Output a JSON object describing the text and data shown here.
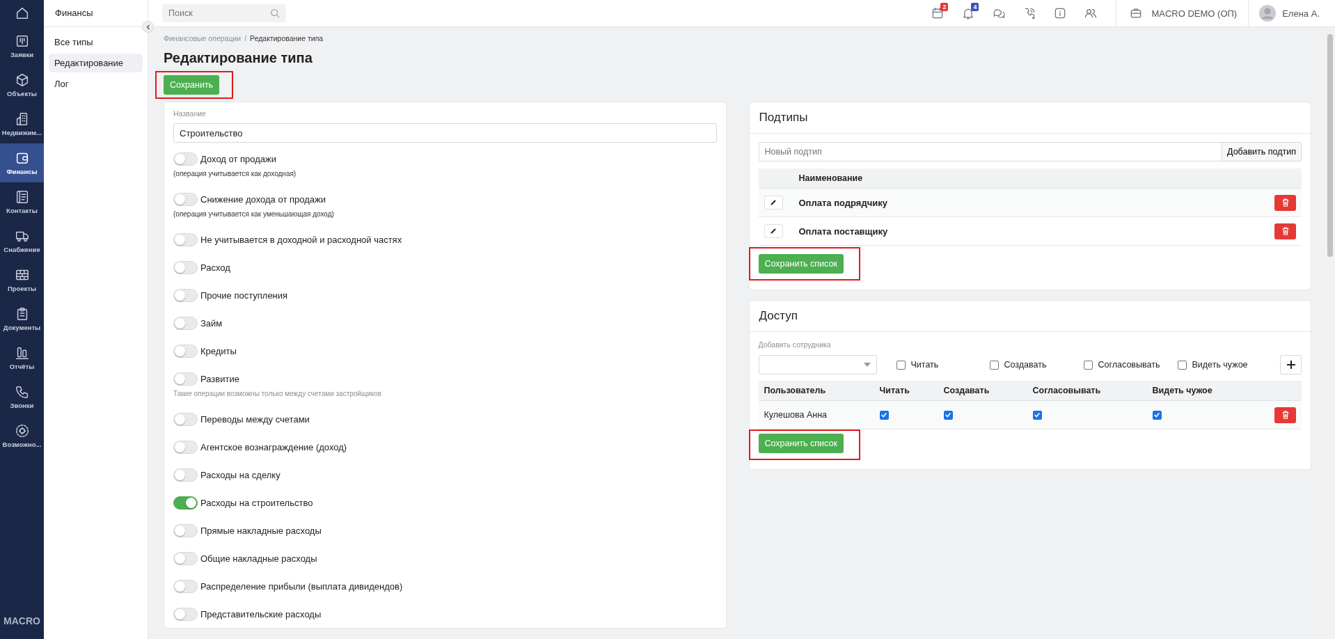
{
  "rail": {
    "items": [
      {
        "kind": "home",
        "selected": false
      },
      {
        "kind": "board",
        "label": "Заявки",
        "selected": false
      },
      {
        "kind": "cube",
        "label": "Объекты",
        "selected": false
      },
      {
        "kind": "building",
        "label": "Недвижим...",
        "selected": false
      },
      {
        "kind": "wallet",
        "label": "Финансы",
        "selected": true
      },
      {
        "kind": "contacts",
        "label": "Контакты",
        "selected": false
      },
      {
        "kind": "truck",
        "label": "Снабжение",
        "selected": false
      },
      {
        "kind": "bricks",
        "label": "Проекты",
        "selected": false
      },
      {
        "kind": "clipboard",
        "label": "Документы",
        "selected": false
      },
      {
        "kind": "reports",
        "label": "Отчёты",
        "selected": false
      },
      {
        "kind": "phone",
        "label": "Звонки",
        "selected": false
      },
      {
        "kind": "gear",
        "label": "Возможно...",
        "selected": false
      }
    ],
    "logo": "MACRO"
  },
  "sidebar": {
    "title": "Финансы",
    "items": [
      {
        "label": "Все типы",
        "selected": false
      },
      {
        "label": "Редактирование",
        "selected": true
      },
      {
        "label": "Лог",
        "selected": false
      }
    ]
  },
  "topbar": {
    "search": {
      "placeholder": "Поиск"
    },
    "icons": [
      {
        "kind": "calendar",
        "badge": "2",
        "color": "#e53935"
      },
      {
        "kind": "bell",
        "badge": "4",
        "color": "#3f51b5"
      },
      {
        "kind": "chats"
      },
      {
        "kind": "phone"
      },
      {
        "kind": "info"
      },
      {
        "kind": "users"
      }
    ],
    "company": "MACRO DEMO (ОП)",
    "user": "Елена А."
  },
  "breadcrumb_separator": "/",
  "breadcrumb": [
    {
      "label": "Финансовые операции"
    },
    {
      "label": "Редактирование типа"
    }
  ],
  "title": "Редактирование типа",
  "save_button": {
    "label": "Сохранить",
    "highlighted": true
  },
  "form": {
    "name_label": "Название",
    "name_value": "Строительство",
    "toggles": [
      {
        "label": "Доход от продажи",
        "on": false,
        "hint": "(операция учитывается как доходная)",
        "hint_muted": false
      },
      {
        "label": "Снижение дохода от продажи",
        "on": false,
        "hint": "(операция учитывается как уменьшающая доход)",
        "hint_muted": false
      },
      {
        "label": "Не учитывается в доходной и расходной частях",
        "on": false
      },
      {
        "label": "Расход",
        "on": false
      },
      {
        "label": "Прочие поступления",
        "on": false
      },
      {
        "label": "Займ",
        "on": false
      },
      {
        "label": "Кредиты",
        "on": false
      },
      {
        "label": "Развитие",
        "on": false,
        "hint": "Такие операции возможны только между счетами застройщиков",
        "hint_muted": true
      },
      {
        "label": "Переводы между счетами",
        "on": false
      },
      {
        "label": "Агентское вознаграждение (доход)",
        "on": false
      },
      {
        "label": "Расходы на сделку",
        "on": false
      },
      {
        "label": "Расходы на строительство",
        "on": true
      },
      {
        "label": "Прямые накладные расходы",
        "on": false
      },
      {
        "label": "Общие накладные расходы",
        "on": false
      },
      {
        "label": "Распределение прибыли (выплата дивидендов)",
        "on": false
      },
      {
        "label": "Представительские расходы",
        "on": false
      }
    ]
  },
  "subtypes": {
    "title": "Подтипы",
    "placeholder": "Новый подтип",
    "add_button": "Добавить подтип",
    "column": "Наименование",
    "rows": [
      {
        "name": "Оплата подрядчику"
      },
      {
        "name": "Оплата поставщику"
      }
    ],
    "save_button": {
      "label": "Сохранить список",
      "highlighted": true
    }
  },
  "access": {
    "title": "Доступ",
    "field_label": "Добавить сотрудника",
    "checkboxes": [
      {
        "label": "Читать",
        "checked": false
      },
      {
        "label": "Создавать",
        "checked": false
      },
      {
        "label": "Согласовывать",
        "checked": false
      },
      {
        "label": "Видеть чужое",
        "checked": false
      }
    ],
    "columns": [
      "Пользователь",
      "Читать",
      "Создавать",
      "Согласовывать",
      "Видеть чужое"
    ],
    "rows": [
      {
        "user": "Кулешова Анна",
        "perms": [
          true,
          true,
          true,
          true
        ]
      }
    ],
    "save_button": {
      "label": "Сохранить список",
      "highlighted": true
    }
  }
}
